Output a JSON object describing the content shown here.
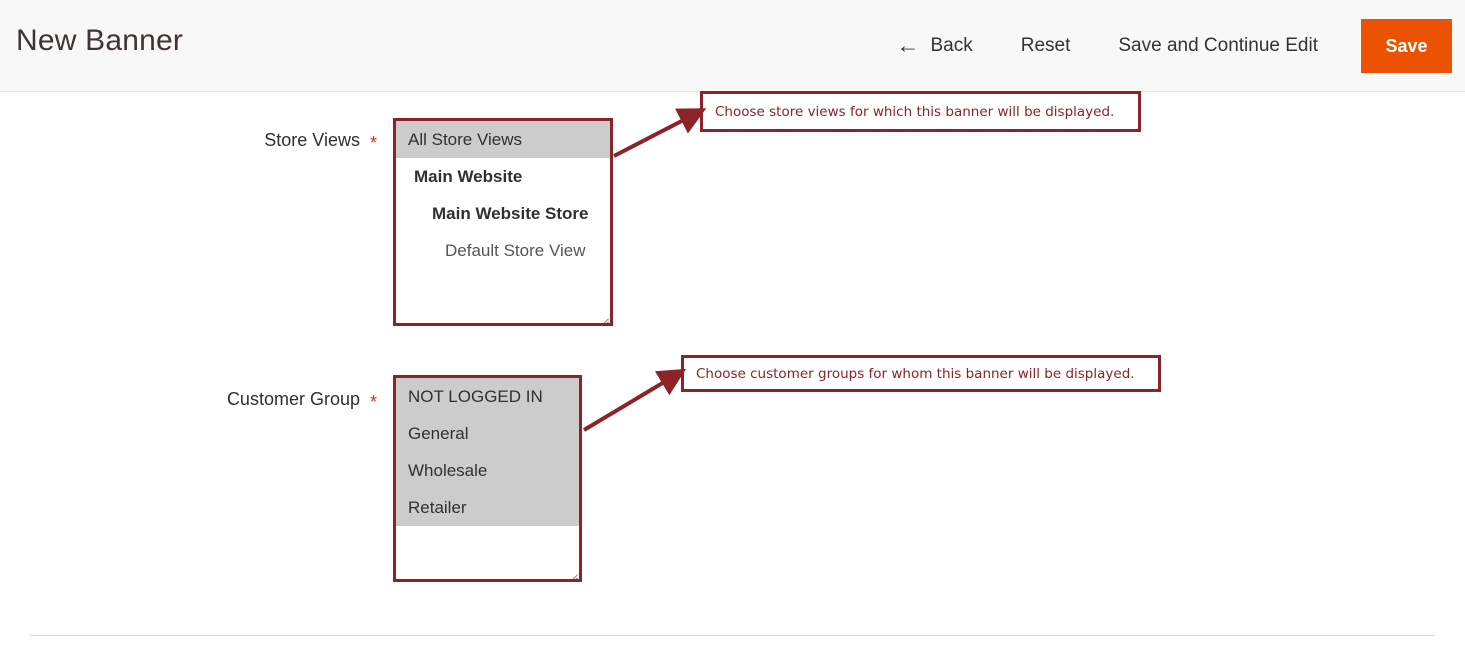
{
  "header": {
    "title": "New Banner",
    "actions": [
      {
        "name": "back",
        "label": "Back",
        "icon": "arrow-left-icon",
        "glyph": "←"
      },
      {
        "name": "reset",
        "label": "Reset"
      },
      {
        "name": "save-and-continue",
        "label": "Save and Continue Edit"
      }
    ],
    "primary_action": {
      "name": "save",
      "label": "Save",
      "color": "#eb5202"
    }
  },
  "form": {
    "fields": [
      {
        "name": "store-views",
        "label": "Store Views",
        "required_marker": "*",
        "options": [
          {
            "text": "All Store Views",
            "level": 0,
            "selected": true
          },
          {
            "text": "Main Website",
            "level": 1,
            "selected": false
          },
          {
            "text": "Main Website Store",
            "level": 2,
            "selected": false
          },
          {
            "text": "Default Store View",
            "level": 3,
            "selected": false
          }
        ]
      },
      {
        "name": "customer-group",
        "label": "Customer Group",
        "required_marker": "*",
        "options": [
          {
            "text": "NOT LOGGED IN",
            "level": 0,
            "selected": true
          },
          {
            "text": "General",
            "level": 0,
            "selected": true
          },
          {
            "text": "Wholesale",
            "level": 0,
            "selected": true
          },
          {
            "text": "Retailer",
            "level": 0,
            "selected": true
          }
        ]
      }
    ]
  },
  "annotations": [
    {
      "name": "store-views-hint",
      "text": "Choose store views for which this banner will be displayed."
    },
    {
      "name": "customer-group-hint",
      "text": "Choose customer groups for whom this banner will be displayed."
    }
  ],
  "colors": {
    "annotation": "#8b2328",
    "primary": "#eb5202",
    "required": "#e02b27",
    "selected_option_bg": "#cccccc"
  }
}
